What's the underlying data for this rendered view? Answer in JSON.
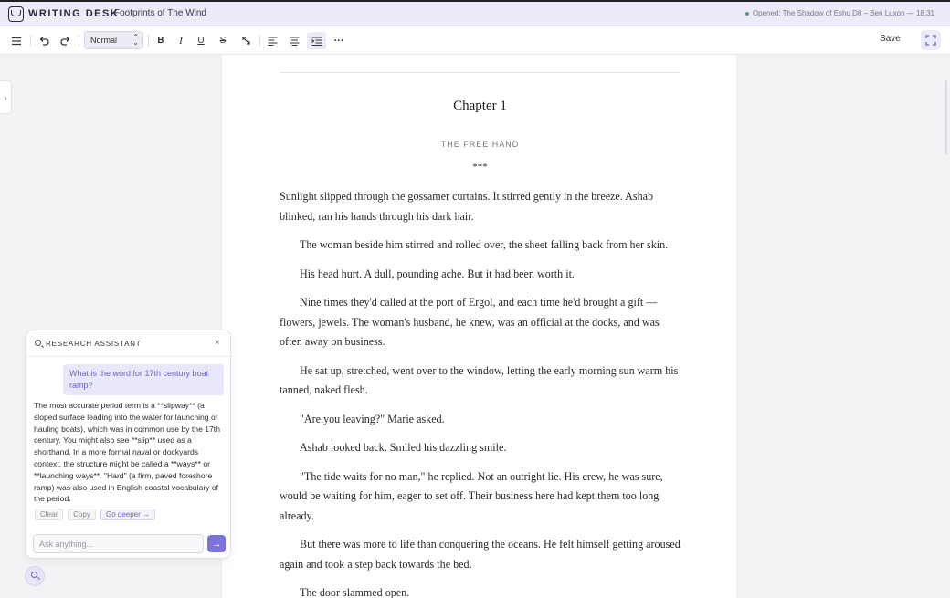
{
  "header": {
    "app_name": "WRITING DESK",
    "document_title": "Footprints of The Wind",
    "status": "Opened: The Shadow of Eshu D8 – Ben Luxon — 18:31"
  },
  "toolbar": {
    "menu_icon": "hamburger-icon",
    "undo_icon": "undo-icon",
    "redo_icon": "redo-icon",
    "style_select_value": "Normal",
    "bold_label": "B",
    "italic_label": "I",
    "underline_label": "U",
    "strike_label": "S",
    "more_label": "···",
    "save_label": "Save"
  },
  "document": {
    "chapter_title": "Chapter 1",
    "chapter_subtitle": "THE FREE HAND",
    "separator": "***",
    "paragraphs": [
      "Sunlight slipped through the gossamer curtains. It stirred gently in the breeze. Ashab blinked, ran his hands through his dark hair.",
      "The woman beside him stirred and rolled over, the sheet falling back from her skin.",
      "His head hurt. A dull, pounding ache. But it had been worth it.",
      "Nine times they'd called at the port of Ergol, and each time he'd brought a gift — flowers, jewels. The woman's husband, he knew, was an official at the docks, and was often away on business.",
      "He sat up, stretched, went over to the window, letting the early morning sun warm his tanned, naked flesh.",
      "\"Are you leaving?\" Marie asked.",
      "Ashab looked back. Smiled his dazzling smile.",
      "\"The tide waits for no man,\" he replied. Not an outright lie. His crew, he was sure, would be waiting for him, eager to set off. Their business here had kept them too long already.",
      "But there was more to life than conquering the oceans. He felt himself getting aroused again and took a step back towards the bed.",
      "The door slammed open."
    ]
  },
  "assistant": {
    "title": "RESEARCH ASSISTANT",
    "close_label": "×",
    "question": "What is the word for 17th century boat ramp?",
    "answer": "The most accurate period term is a **slipway** (a sloped surface leading into the water for launching or hauling boats), which was in common use by the 17th century. You might also see **slip** used as a shorthand. In a more formal naval or dockyards context, the structure might be called a **ways** or **launching ways**. \"Hard\" (a firm, paved foreshore ramp) was also used in English coastal vocabulary of the period.",
    "clear_label": "Clear",
    "copy_label": "Copy",
    "deeper_label": "Go deeper →",
    "input_placeholder": "Ask anything...",
    "send_label": "→"
  },
  "colors": {
    "accent": "#7c73d8",
    "header_bg": "#ecebfa",
    "status_dot": "#5a9a76"
  }
}
